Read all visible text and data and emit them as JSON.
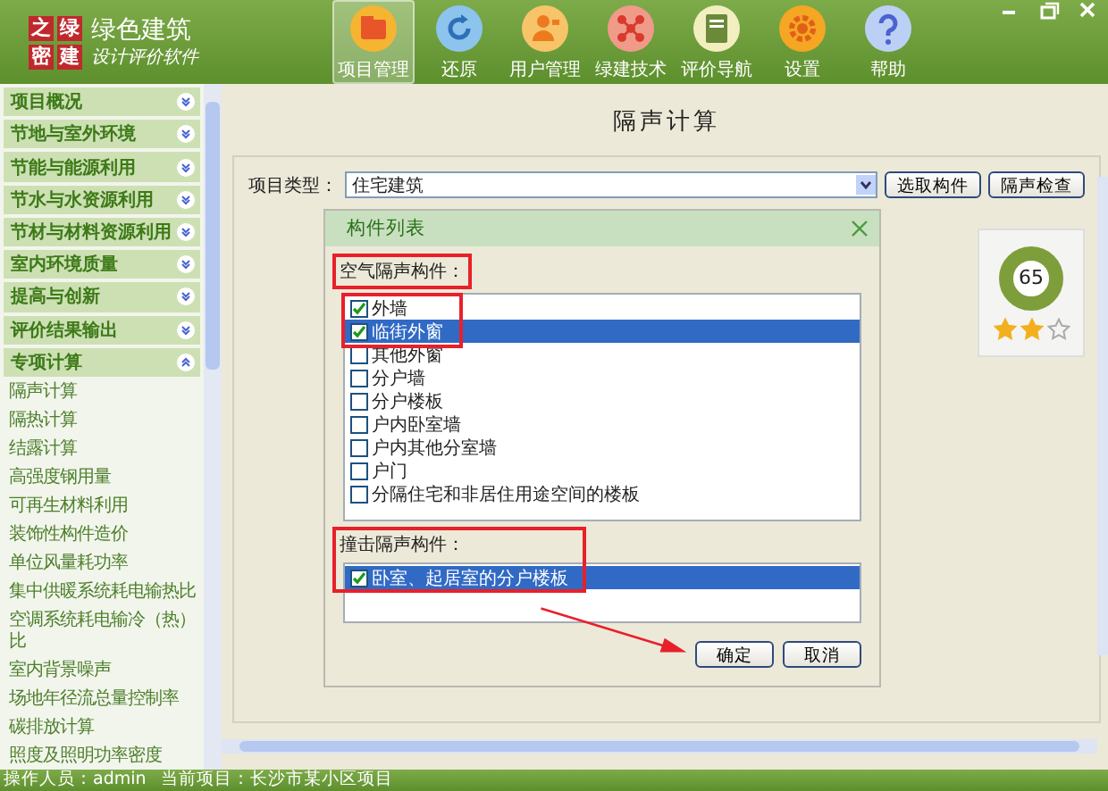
{
  "app": {
    "logo_chars": [
      "之",
      "绿",
      "密",
      "建"
    ],
    "title": "绿色建筑",
    "subtitle": "设计评价软件"
  },
  "toolbar": [
    {
      "label": "项目管理",
      "selected": true
    },
    {
      "label": "还原",
      "selected": false
    },
    {
      "label": "用户管理",
      "selected": false
    },
    {
      "label": "绿建技术",
      "selected": false
    },
    {
      "label": "评价导航",
      "selected": false
    },
    {
      "label": "设置",
      "selected": false
    },
    {
      "label": "帮助",
      "selected": false
    }
  ],
  "sidebar": {
    "groups": [
      {
        "label": "项目概况",
        "expanded": false
      },
      {
        "label": "节地与室外环境",
        "expanded": false
      },
      {
        "label": "节能与能源利用",
        "expanded": false
      },
      {
        "label": "节水与水资源利用",
        "expanded": false
      },
      {
        "label": "节材与材料资源利用",
        "expanded": false
      },
      {
        "label": "室内环境质量",
        "expanded": false
      },
      {
        "label": "提高与创新",
        "expanded": false
      },
      {
        "label": "评价结果输出",
        "expanded": false
      },
      {
        "label": "专项计算",
        "expanded": true,
        "children": [
          {
            "label": "隔声计算"
          },
          {
            "label": "隔热计算"
          },
          {
            "label": "结露计算"
          },
          {
            "label": "高强度钢用量"
          },
          {
            "label": "可再生材料利用"
          },
          {
            "label": "装饰性构件造价"
          },
          {
            "label": "单位风量耗功率"
          },
          {
            "label": "集中供暖系统耗电输热比"
          },
          {
            "label": "空调系统耗电输冷（热）比"
          },
          {
            "label": "室内背景噪声"
          },
          {
            "label": "场地年径流总量控制率"
          },
          {
            "label": "碳排放计算"
          },
          {
            "label": "照度及照明功率密度"
          }
        ]
      }
    ]
  },
  "page": {
    "title": "隔声计算",
    "project_type_label": "项目类型：",
    "project_type": "住宅建筑",
    "buttons": [
      "选取构件",
      "隔声检查"
    ]
  },
  "dialog": {
    "title": "构件列表",
    "airborne_label": "空气隔声构件：",
    "airborne_items": [
      {
        "label": "外墙",
        "checked": true,
        "selected": false
      },
      {
        "label": "临街外窗",
        "checked": true,
        "selected": true
      },
      {
        "label": "其他外窗",
        "checked": false,
        "selected": false
      },
      {
        "label": "分户墙",
        "checked": false,
        "selected": false
      },
      {
        "label": "分户楼板",
        "checked": false,
        "selected": false
      },
      {
        "label": "户内卧室墙",
        "checked": false,
        "selected": false
      },
      {
        "label": "户内其他分室墙",
        "checked": false,
        "selected": false
      },
      {
        "label": "户门",
        "checked": false,
        "selected": false
      },
      {
        "label": "分隔住宅和非居住用途空间的楼板",
        "checked": false,
        "selected": false
      }
    ],
    "impact_label": "撞击隔声构件：",
    "impact_items": [
      {
        "label": "卧室、起居室的分户楼板",
        "checked": true,
        "selected": true
      }
    ],
    "buttons": [
      "确定",
      "取消"
    ]
  },
  "score": {
    "value": "65",
    "stars": 2
  },
  "status_bar": {
    "operator": "操作人员：admin",
    "project": "当前项目：长沙市某小区项目"
  }
}
